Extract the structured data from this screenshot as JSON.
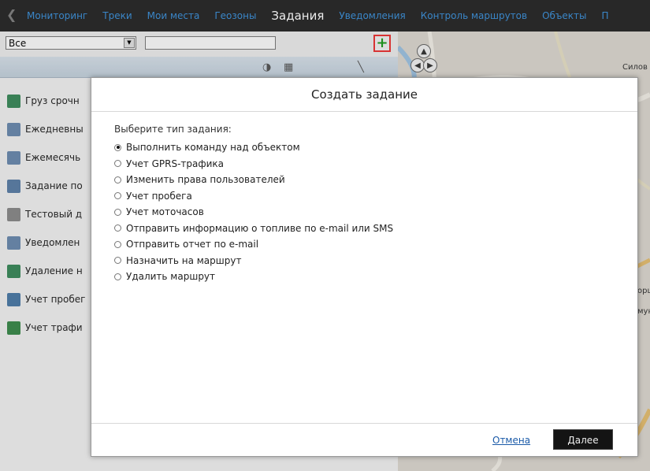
{
  "nav": {
    "items": [
      {
        "label": "Мониторинг"
      },
      {
        "label": "Треки"
      },
      {
        "label": "Мои места"
      },
      {
        "label": "Геозоны"
      },
      {
        "label": "Задания",
        "active": true
      },
      {
        "label": "Уведомления"
      },
      {
        "label": "Контроль маршрутов"
      },
      {
        "label": "Объекты"
      },
      {
        "label": "П"
      }
    ]
  },
  "filter": {
    "selected": "Все",
    "search_value": ""
  },
  "tasks": [
    {
      "label": "Груз срочн",
      "icon": "task-table-icon"
    },
    {
      "label": "Ежедневны",
      "icon": "task-notebook-icon"
    },
    {
      "label": "Ежемесячь",
      "icon": "task-notebook-icon"
    },
    {
      "label": "Задание по",
      "icon": "task-clock-icon"
    },
    {
      "label": "Тестовый д",
      "icon": "task-users-icon"
    },
    {
      "label": "Уведомлен",
      "icon": "task-notebook-icon"
    },
    {
      "label": "Удаление н",
      "icon": "task-delete-icon"
    },
    {
      "label": "Учет пробег",
      "icon": "task-grid-icon"
    },
    {
      "label": "Учет трафи",
      "icon": "task-traffic-icon"
    }
  ],
  "map": {
    "labels": [
      "Силов",
      "орц",
      "мун"
    ]
  },
  "dialog": {
    "title": "Создать задание",
    "prompt": "Выберите тип задания:",
    "options": [
      {
        "label": "Выполнить команду над объектом",
        "checked": true
      },
      {
        "label": "Учет GPRS-трафика",
        "checked": false
      },
      {
        "label": "Изменить права пользователей",
        "checked": false
      },
      {
        "label": "Учет пробега",
        "checked": false
      },
      {
        "label": "Учет моточасов",
        "checked": false
      },
      {
        "label": "Отправить информацию о топливе по e-mail или SMS",
        "checked": false
      },
      {
        "label": "Отправить отчет по e-mail",
        "checked": false
      },
      {
        "label": "Назначить на маршрут",
        "checked": false
      },
      {
        "label": "Удалить маршрут",
        "checked": false
      }
    ],
    "cancel_label": "Отмена",
    "next_label": "Далее"
  },
  "colors": {
    "nav_bg": "#282828",
    "nav_link": "#3a86c8",
    "nav_active": "#ececec",
    "add_border": "#e33333",
    "add_plus": "#1a9a1a",
    "next_bg": "#141414"
  }
}
